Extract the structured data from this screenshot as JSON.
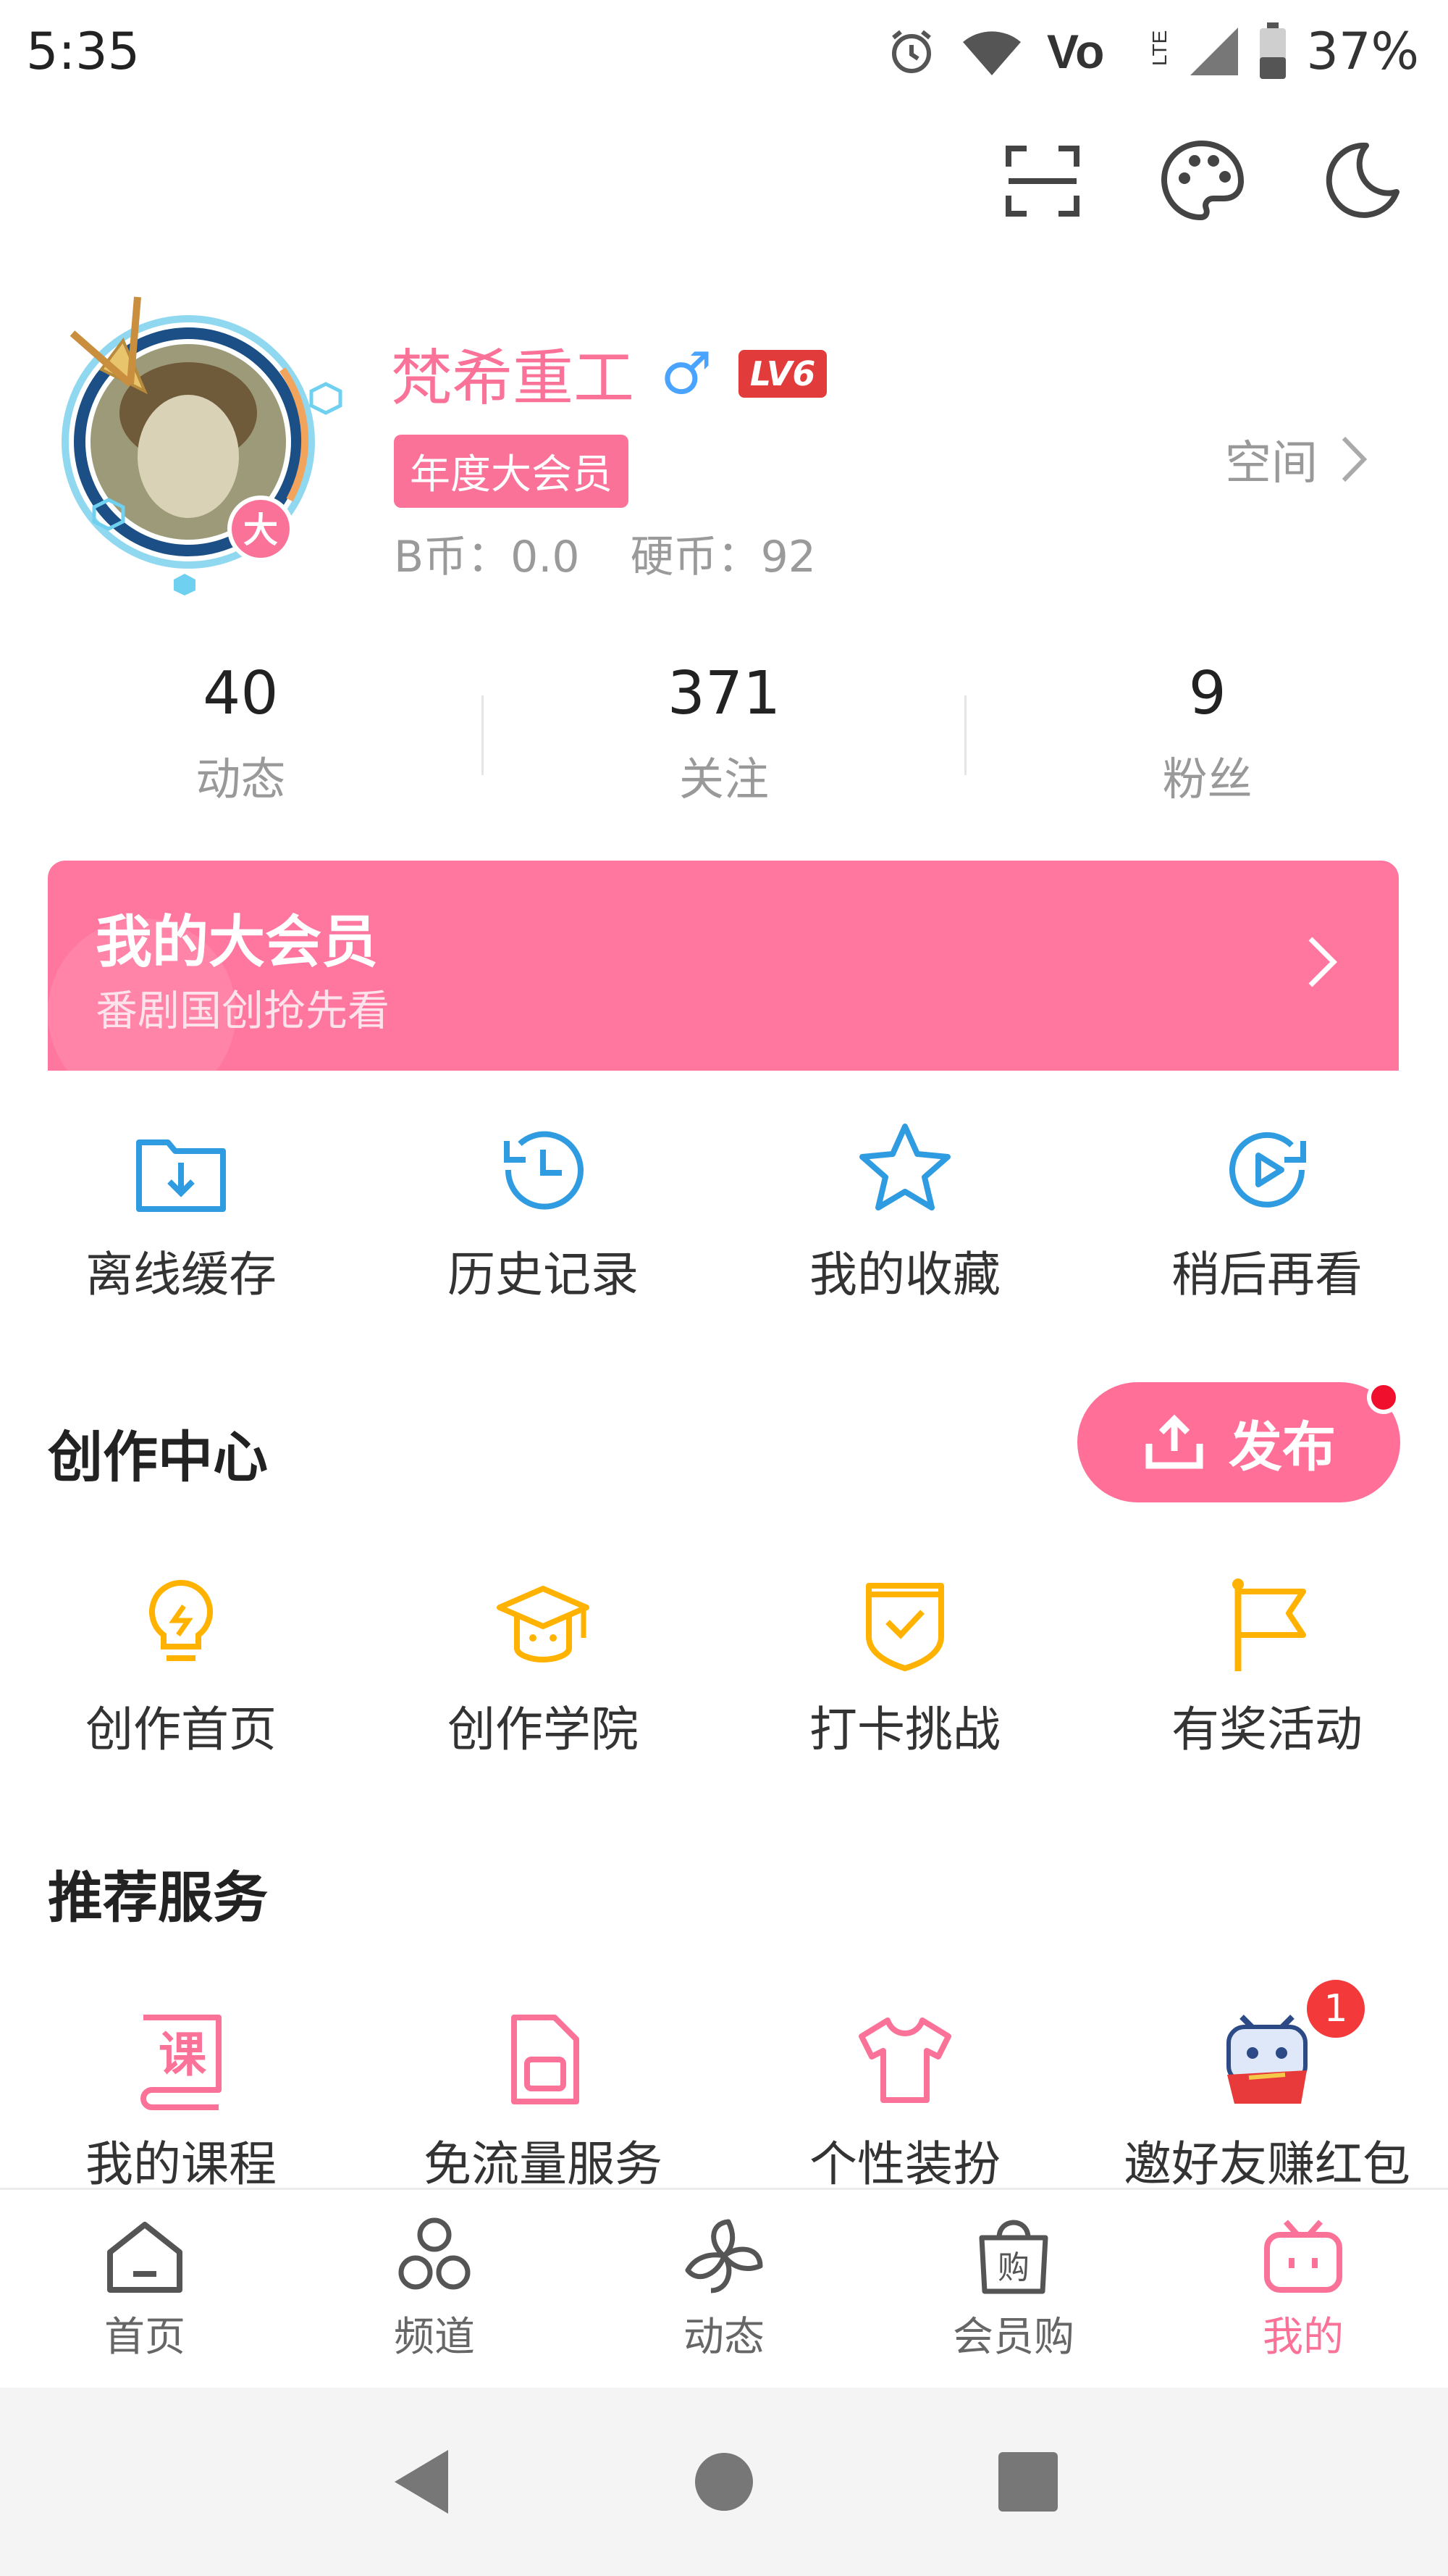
{
  "status_bar": {
    "time": "5:35",
    "battery_percent": "37%"
  },
  "top_actions": [
    "scan-icon",
    "palette-icon",
    "night-mode-icon"
  ],
  "profile": {
    "username": "梵希重工",
    "gender_symbol": "♂",
    "level": "LV6",
    "vip_tag": "年度大会员",
    "b_coins": "B币：0.0",
    "coins": "硬币：92",
    "space_label": "空间",
    "avatar_badge": "大"
  },
  "stats": [
    {
      "value": "40",
      "label": "动态"
    },
    {
      "value": "371",
      "label": "关注"
    },
    {
      "value": "9",
      "label": "粉丝"
    }
  ],
  "vip_banner": {
    "title": "我的大会员",
    "subtitle": "番剧国创抢先看"
  },
  "quick_actions": [
    {
      "label": "离线缓存",
      "icon": "download-folder-icon"
    },
    {
      "label": "历史记录",
      "icon": "history-clock-icon"
    },
    {
      "label": "我的收藏",
      "icon": "star-icon"
    },
    {
      "label": "稍后再看",
      "icon": "watch-later-icon"
    }
  ],
  "creation_center": {
    "title": "创作中心",
    "publish_label": "发布",
    "items": [
      {
        "label": "创作首页",
        "icon": "lightbulb-icon"
      },
      {
        "label": "创作学院",
        "icon": "graduation-cap-icon"
      },
      {
        "label": "打卡挑战",
        "icon": "shield-check-icon"
      },
      {
        "label": "有奖活动",
        "icon": "flag-icon"
      }
    ]
  },
  "recommended_services": {
    "title": "推荐服务",
    "items": [
      {
        "label": "我的课程",
        "icon": "course-book-icon",
        "glyph": "课"
      },
      {
        "label": "免流量服务",
        "icon": "sim-card-icon"
      },
      {
        "label": "个性装扮",
        "icon": "tshirt-icon"
      },
      {
        "label": "邀好友赚红包",
        "icon": "tv-mascot-icon",
        "badge": "1"
      }
    ]
  },
  "bottom_nav": [
    {
      "label": "首页",
      "icon": "home-icon"
    },
    {
      "label": "频道",
      "icon": "channels-icon"
    },
    {
      "label": "动态",
      "icon": "pinwheel-icon"
    },
    {
      "label": "会员购",
      "icon": "shopping-bag-icon",
      "glyph": "购"
    },
    {
      "label": "我的",
      "icon": "tv-icon",
      "active": true
    }
  ],
  "colors": {
    "brand_pink": "#fb7299",
    "blue": "#2f9be0",
    "yellow": "#ffb300"
  }
}
